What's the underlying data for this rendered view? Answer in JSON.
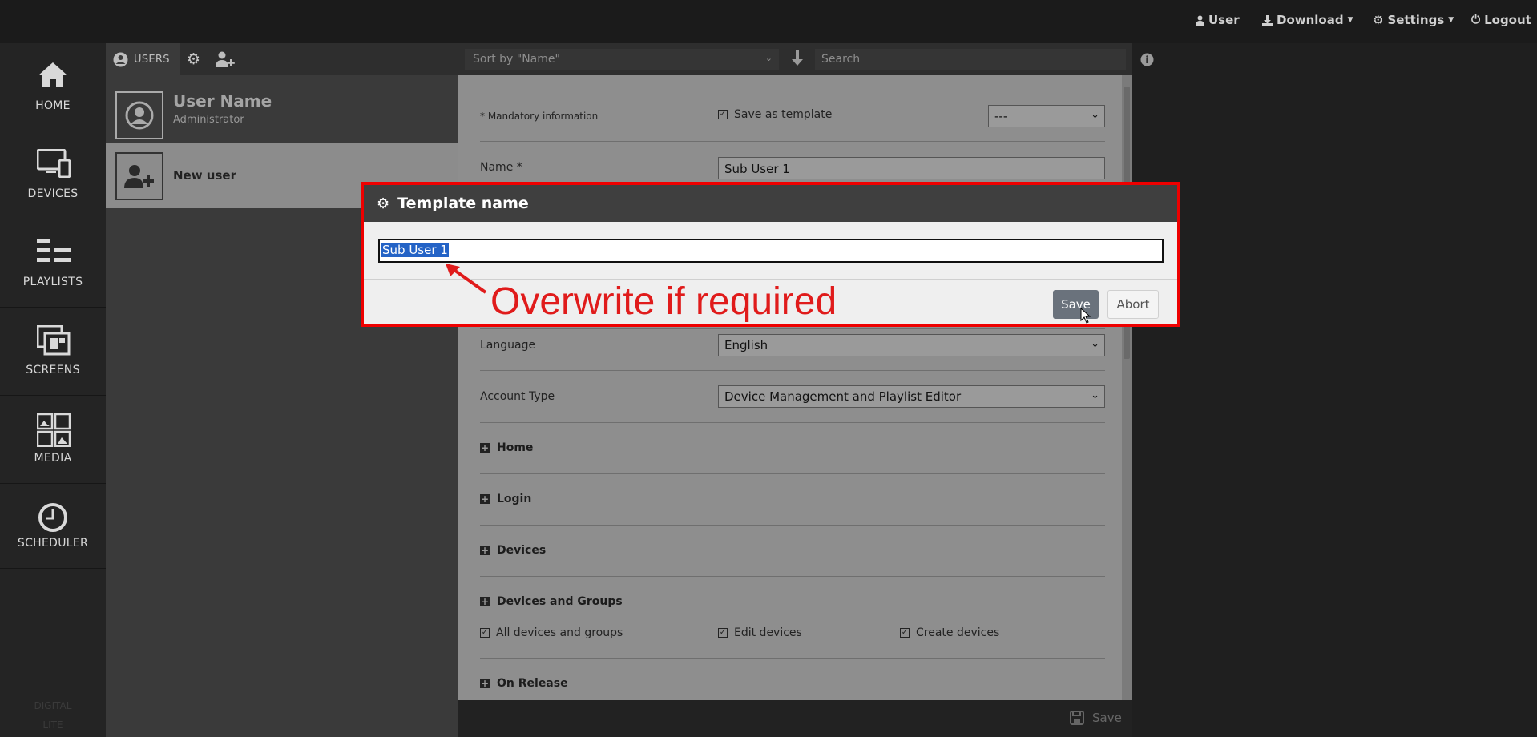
{
  "topbar": {
    "user_label": "User",
    "download_label": "Download",
    "settings_label": "Settings",
    "logout_label": "Logout"
  },
  "nav": {
    "items": [
      {
        "label": "HOME"
      },
      {
        "label": "DEVICES"
      },
      {
        "label": "PLAYLISTS"
      },
      {
        "label": "SCREENS"
      },
      {
        "label": "MEDIA"
      },
      {
        "label": "SCHEDULER"
      }
    ],
    "bottom_line1": "DIGITAL",
    "bottom_line2": "LITE"
  },
  "users": {
    "tab_label": "USERS",
    "current_user": {
      "name": "User Name",
      "role": "Administrator"
    },
    "new_user_label": "New user"
  },
  "toolbar": {
    "sort_value": "Sort by \"Name\"",
    "search_placeholder": "Search"
  },
  "form": {
    "mandatory_note": "* Mandatory information",
    "save_as_template_label": "Save as template",
    "template_select_value": "---",
    "name_label": "Name *",
    "name_value": "Sub User 1",
    "language_label": "Language",
    "language_value": "English",
    "account_type_label": "Account Type",
    "account_type_value": "Device Management and Playlist Editor",
    "sections": [
      "Home",
      "Login",
      "Devices",
      "Devices and Groups",
      "On Release"
    ],
    "devices_groups_checks": [
      "All devices and groups",
      "Edit devices",
      "Create devices"
    ],
    "save_label": "Save"
  },
  "dialog": {
    "title": "Template name",
    "input_value": "Sub User 1",
    "annotation": "Overwrite if required",
    "save_label": "Save",
    "abort_label": "Abort"
  },
  "colors": {
    "annotation_red": "#e01b1b",
    "dialog_header": "#3f3f3f",
    "selection_blue": "#2463c6"
  }
}
